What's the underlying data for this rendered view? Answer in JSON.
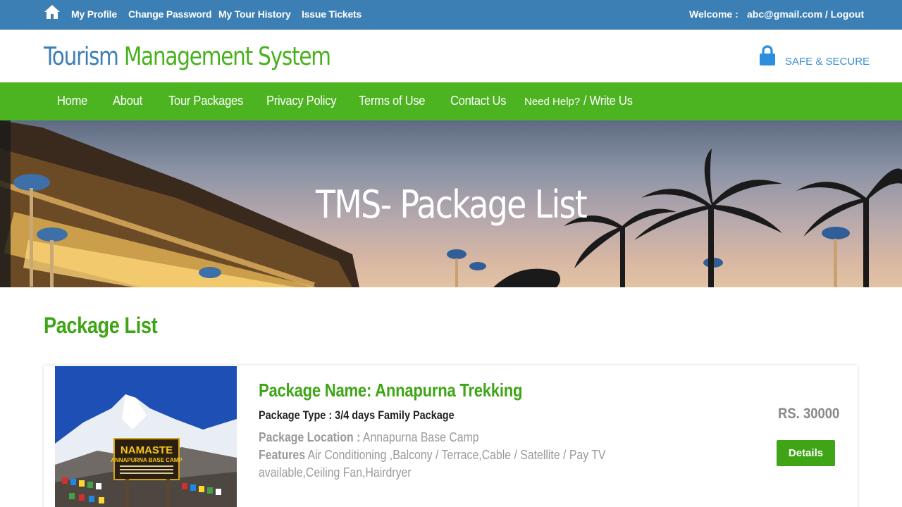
{
  "topbar": {
    "links": [
      "My Profile",
      "Change Password",
      "My Tour History",
      "Issue Tickets"
    ],
    "welcome_label": "Welcome :",
    "account_text": "abc@gmail.com / Logout"
  },
  "header": {
    "logo_part1": "Tourism",
    "logo_part2": "Management System",
    "secure_label": "SAFE & SECURE"
  },
  "nav": {
    "items": [
      "Home",
      "About",
      "Tour Packages",
      "Privacy Policy",
      "Terms of Use",
      "Contact Us"
    ],
    "need_help": "Need Help?",
    "write_us": "/ Write Us"
  },
  "banner": {
    "title": "TMS- Package List"
  },
  "main": {
    "section_title": "Package List",
    "packages": [
      {
        "name": "Package Name: Annapurna Trekking",
        "type": "Package Type : 3/4 days Family Package",
        "location_label": "Package Location :",
        "location": "Annapurna Base Camp",
        "features_label": "Features",
        "features_line1": "Air Conditioning ,Balcony / Terrace,Cable / Satellite / Pay TV",
        "features_line2": "available,Ceiling Fan,Hairdryer",
        "price": "RS. 30000",
        "details_label": "Details",
        "image_sign_line1": "NAMASTE",
        "image_sign_line2": "ANNAPURNA BASE CAMP"
      }
    ]
  },
  "colors": {
    "topbar": "#3b7fb4",
    "nav": "#4cb321",
    "accent_green": "#3fa516",
    "accent_blue": "#3b7fb4"
  },
  "icons": [
    "home-icon",
    "lock-icon"
  ]
}
